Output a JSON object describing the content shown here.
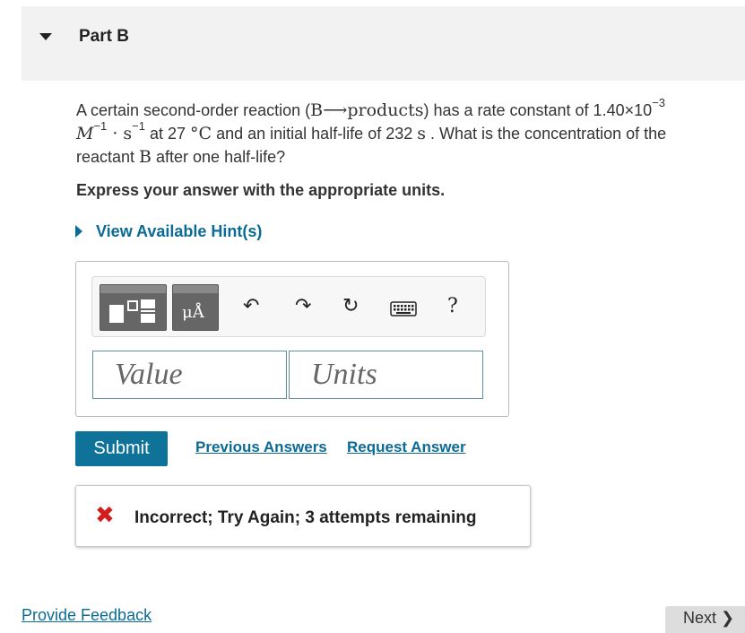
{
  "part": {
    "title": "Part B"
  },
  "question": {
    "t1": "A certain second-order reaction (",
    "reaction": "B⟶products",
    "t2": ") has a rate constant of 1.40×10",
    "rate_exp": "−3",
    "unit_M": "M",
    "unit_M_exp": "−1",
    "unit_dot_s": " · s",
    "unit_s_exp": "−1",
    "t3": " at 27 ",
    "temp_unit": "°C",
    "t4": " and an initial half-life of 232 ",
    "time_unit": "s",
    "t5": " . What is the concentration of the",
    "t6": "reactant ",
    "species": "B",
    "t7": " after one half-life?"
  },
  "instruction": "Express your answer with the appropriate units.",
  "hint_link": "View Available Hint(s)",
  "toolbar": {
    "unit_symbol": "μÅ",
    "icons": [
      "templates-icon",
      "units-icon",
      "undo-icon",
      "redo-icon",
      "reset-icon",
      "keyboard-icon",
      "help-icon"
    ],
    "undo_glyph": "↶",
    "redo_glyph": "↷",
    "reset_glyph": "↻",
    "help_glyph": "?"
  },
  "inputs": {
    "value_placeholder": "Value",
    "units_placeholder": "Units"
  },
  "actions": {
    "submit": "Submit",
    "previous_answers": "Previous Answers",
    "request_answer": "Request Answer"
  },
  "feedback": {
    "icon": "✖",
    "message": "Incorrect; Try Again; 3 attempts remaining"
  },
  "footer": {
    "provide_feedback": "Provide Feedback",
    "next": "Next ❯"
  },
  "colors": {
    "link": "#0c6b94",
    "submit_bg": "#0f7299",
    "error": "#d41c1c",
    "header_bg": "#f2f2f2"
  }
}
